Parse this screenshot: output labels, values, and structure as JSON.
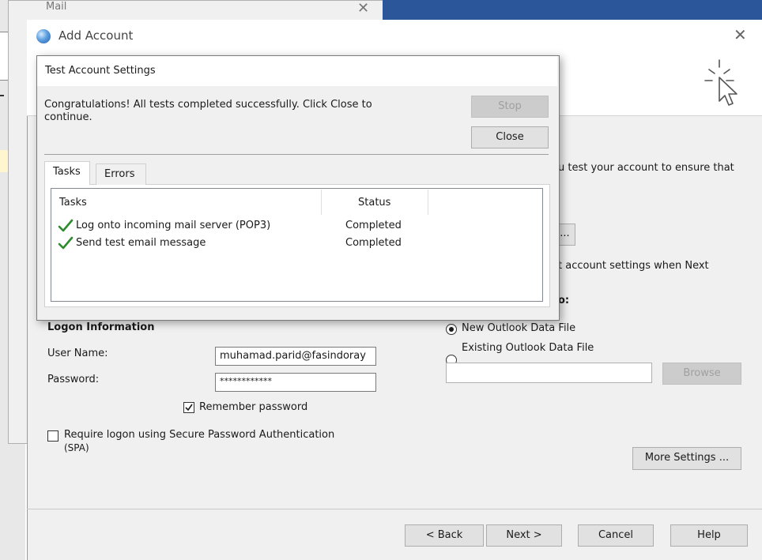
{
  "mail_window": {
    "title": "Mail"
  },
  "add_account": {
    "title": "Add Account",
    "right_text_1": "u test your account to ensure that",
    "right_button_partial": "...",
    "right_text_2": "t account settings when Next",
    "right_text_3": "o:",
    "logon_heading": "Logon Information",
    "user_name_label": "User Name:",
    "user_name_value": "muhamad.parid@fasindoray",
    "password_label": "Password:",
    "password_value": "************",
    "remember_password_label": "Remember password",
    "remember_password_checked": true,
    "spa_label_line1": "Require logon using Secure Password Authentication",
    "spa_label_line2": "(SPA)",
    "spa_checked": false,
    "new_data_file_label": "New Outlook Data File",
    "existing_data_file_label": "Existing Outlook Data File",
    "data_file_path": "",
    "browse_label": "Browse",
    "more_settings_label": "More Settings ...",
    "back_label": "< Back",
    "next_label": "Next >",
    "cancel_label": "Cancel",
    "help_label": "Help"
  },
  "test_dialog": {
    "title": "Test Account Settings",
    "message_line1": "Congratulations! All tests completed successfully. Click Close to",
    "message_line2": "continue.",
    "stop_label": "Stop",
    "close_label": "Close",
    "tabs": [
      {
        "label": "Tasks"
      },
      {
        "label": "Errors"
      }
    ],
    "columns": {
      "tasks": "Tasks",
      "status": "Status"
    },
    "rows": [
      {
        "task": "Log onto incoming mail server (POP3)",
        "status": "Completed"
      },
      {
        "task": "Send test email message",
        "status": "Completed"
      }
    ]
  },
  "colors": {
    "accent": "#2b579a",
    "check_green": "#2e8b2e"
  }
}
